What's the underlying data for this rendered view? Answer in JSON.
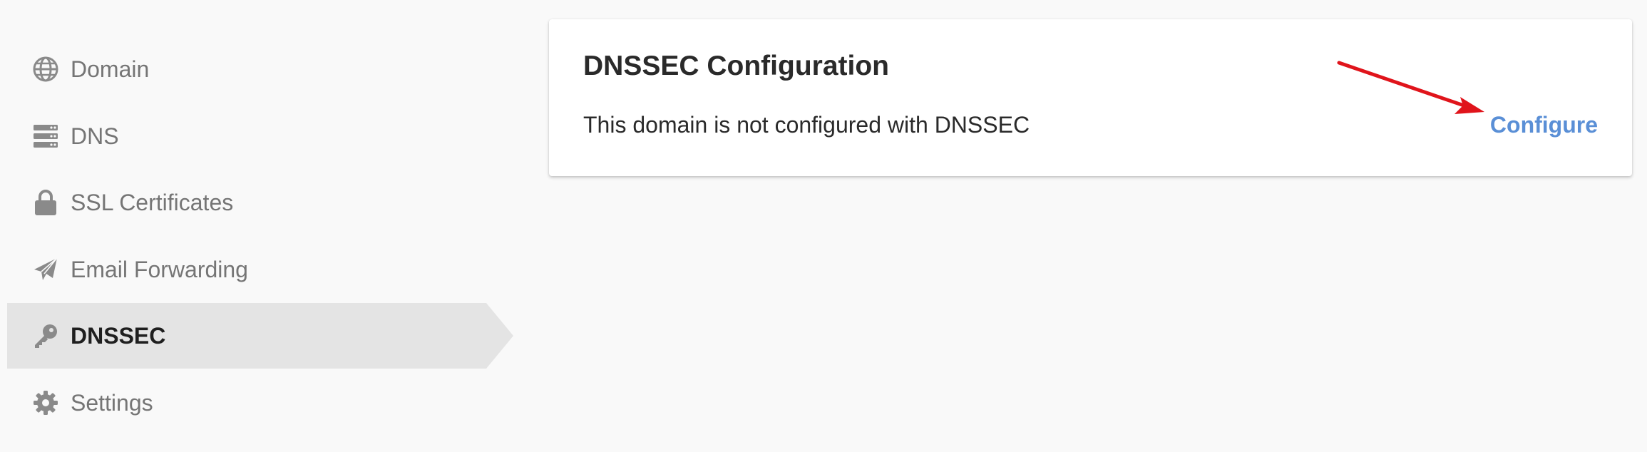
{
  "sidebar": {
    "items": [
      {
        "label": "Domain",
        "icon": "globe-icon",
        "active": false
      },
      {
        "label": "DNS",
        "icon": "server-icon",
        "active": false
      },
      {
        "label": "SSL Certificates",
        "icon": "lock-icon",
        "active": false
      },
      {
        "label": "Email Forwarding",
        "icon": "paper-plane-icon",
        "active": false
      },
      {
        "label": "DNSSEC",
        "icon": "key-icon",
        "active": true
      },
      {
        "label": "Settings",
        "icon": "gear-icon",
        "active": false
      }
    ]
  },
  "card": {
    "title": "DNSSEC Configuration",
    "message": "This domain is not configured with DNSSEC",
    "action_label": "Configure"
  },
  "colors": {
    "background": "#f9f9f9",
    "active_item_bg": "#e4e4e4",
    "icon_gray": "#8a8a8a",
    "link_blue": "#5a8fd6",
    "arrow_red": "#e0141b"
  }
}
